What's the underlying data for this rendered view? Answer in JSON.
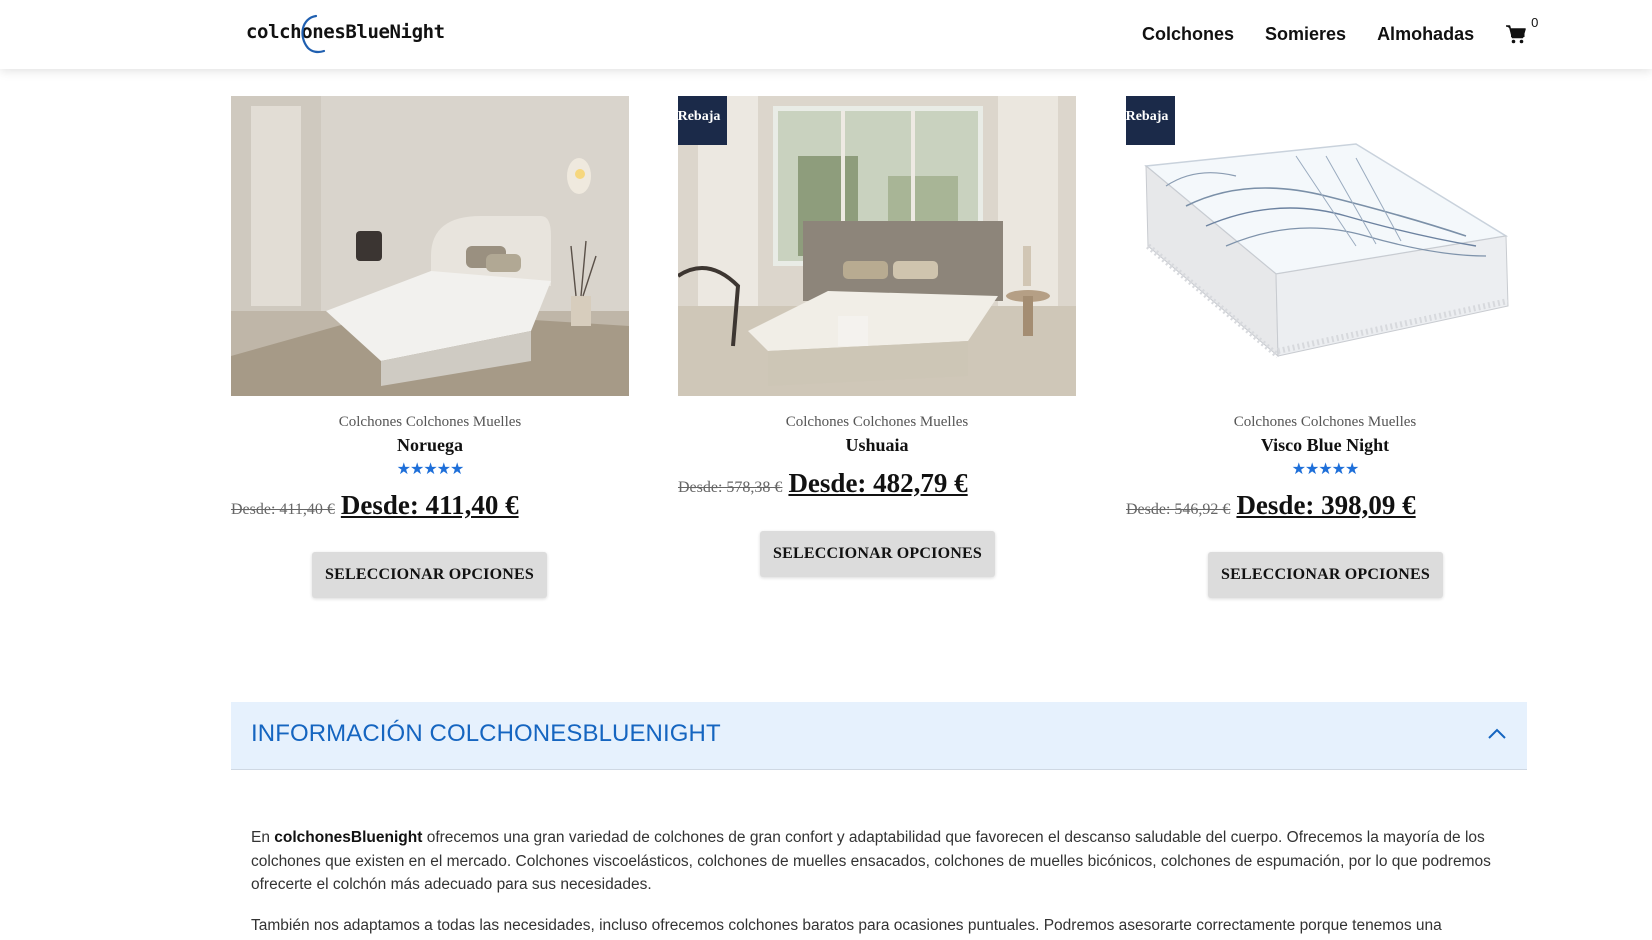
{
  "header": {
    "logo_prefix": "colch",
    "logo_o": "o",
    "logo_suffix": "nesBlueNight",
    "nav": [
      "Colchones",
      "Somieres",
      "Almohadas"
    ],
    "cart_count": "0"
  },
  "products": [
    {
      "badge": "",
      "category": "Colchones Colchones Muelles",
      "name": "Noruega",
      "rating": 5,
      "stars": "★★★★★",
      "old_price": "Desde: 411,40 €",
      "new_price": "Desde: 411,40 €",
      "button": "SELECCIONAR OPCIONES"
    },
    {
      "badge": "Rebaja",
      "category": "Colchones Colchones Muelles",
      "name": "Ushuaia",
      "rating": null,
      "stars": "",
      "old_price": "Desde: 578,38 €",
      "new_price": "Desde: 482,79 €",
      "button": "SELECCIONAR OPCIONES"
    },
    {
      "badge": "Rebaja",
      "category": "Colchones Colchones Muelles",
      "name": "Visco Blue Night",
      "rating": 5,
      "stars": "★★★★★",
      "old_price": "Desde: 546,92 €",
      "new_price": "Desde: 398,09 €",
      "button": "SELECCIONAR OPCIONES"
    }
  ],
  "info": {
    "title": "INFORMACIÓN COLCHONESBLUENIGHT",
    "p1_prefix": "En ",
    "p1_brand": "colchonesBluenight",
    "p1_rest": " ofrecemos una gran variedad de colchones de gran confort y adaptabilidad que favorecen el descanso saludable del cuerpo. Ofrecemos la mayoría de los colchones que existen en el mercado. Colchones viscoelásticos, colchones de muelles ensacados, colchones de muelles bicónicos, colchones de espumación, por lo que podremos ofrecerte el colchón más adecuado para sus necesidades.",
    "p2": "También nos adaptamos a todas las necesidades, incluso ofrecemos colchones baratos para ocasiones puntuales. Podremos asesorarte correctamente porque tenemos una"
  },
  "colors": {
    "accent": "#1565c0",
    "badge_bg": "#1b2a49",
    "star": "#1e6fd9",
    "info_bg": "#e6f1fd",
    "button_bg": "#dcdcdc"
  },
  "icons": [
    "cart-icon",
    "chevron-up-icon",
    "star-icon"
  ]
}
